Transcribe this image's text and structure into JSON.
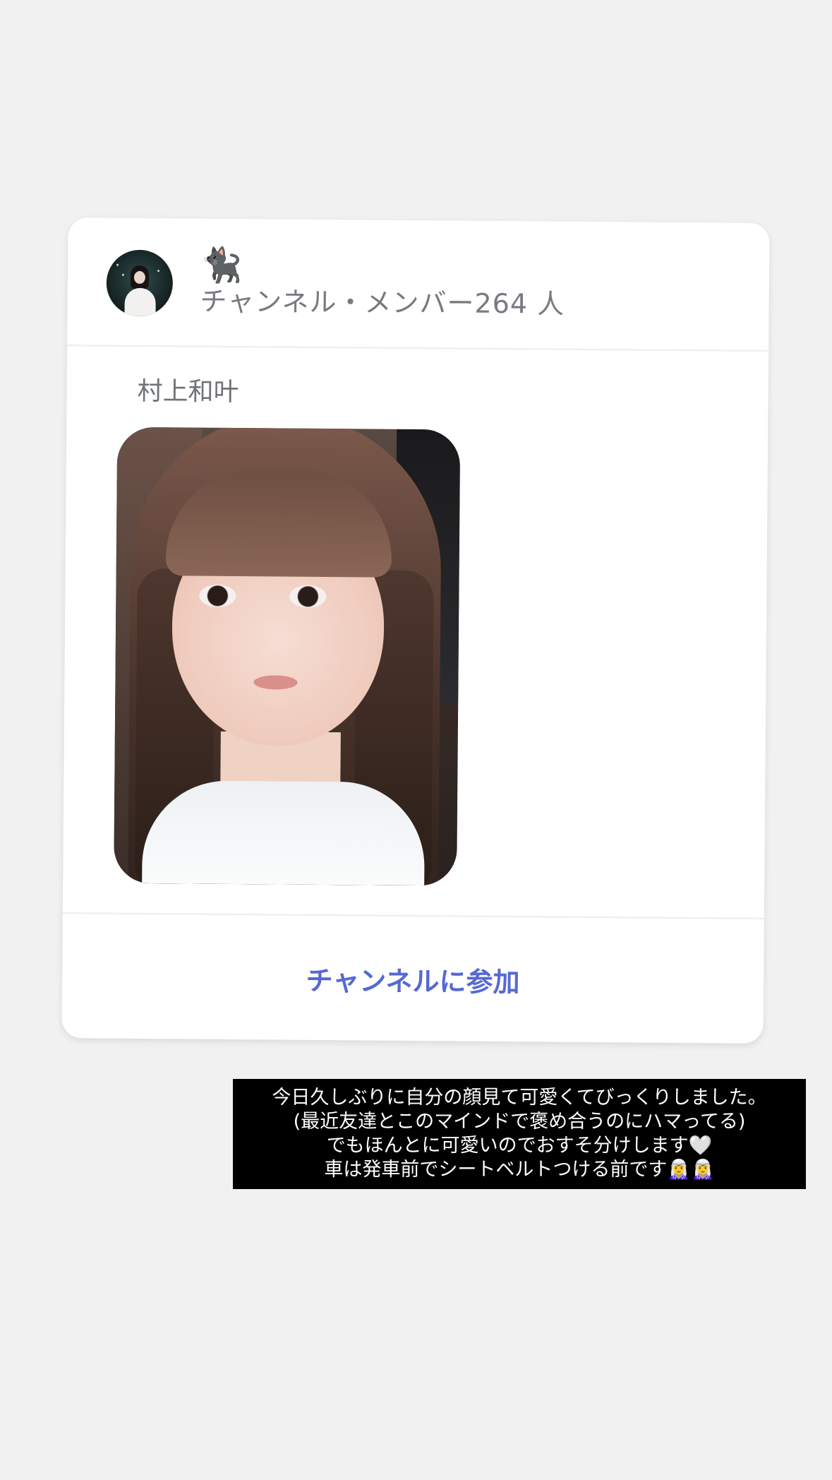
{
  "channel": {
    "icon": "cat-emoji",
    "emoji": "🐈‍⬛",
    "meta": "チャンネル・メンバー264 人"
  },
  "post": {
    "author": "村上和叶",
    "photo_icon": "selfie-photo"
  },
  "actions": {
    "join_label": "チャンネルに参加"
  },
  "caption": {
    "lines": [
      "今日久しぶりに自分の顔見て可愛くてびっくりしました。",
      "(最近友達とこのマインドで褒め合うのにハマってる)",
      "でもほんとに可愛いのでおすそ分けします🤍",
      "車は発車前でシートベルトつける前です🧝‍♀️🧝‍♀️"
    ]
  },
  "colors": {
    "background": "#f1f1f1",
    "card": "#ffffff",
    "accent": "#5469d4",
    "meta_text": "#777a80",
    "caption_bg": "#000000"
  }
}
